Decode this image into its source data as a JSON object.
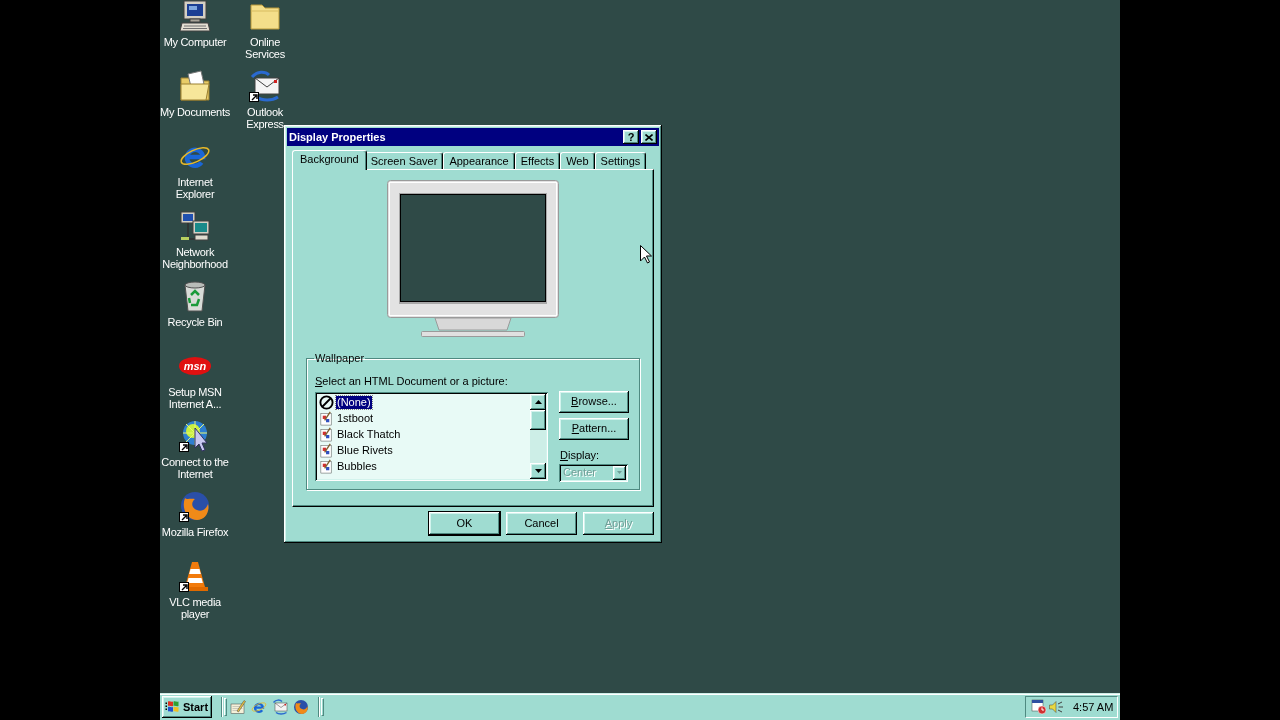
{
  "desktop": {
    "icons": [
      {
        "label": "My Computer",
        "kind": "computer",
        "shortcut": false
      },
      {
        "label": "My Documents",
        "kind": "documents",
        "shortcut": false
      },
      {
        "label": "Internet Explorer",
        "kind": "browser-e",
        "shortcut": false
      },
      {
        "label": "Network Neighborhood",
        "kind": "network",
        "shortcut": false
      },
      {
        "label": "Recycle Bin",
        "kind": "recycle",
        "shortcut": false
      },
      {
        "label": "Setup MSN Internet A...",
        "kind": "msn",
        "logo_text": "msn",
        "shortcut": false
      },
      {
        "label": "Connect to the Internet",
        "kind": "connect",
        "shortcut": true
      },
      {
        "label": "Mozilla Firefox",
        "kind": "firefox",
        "shortcut": true
      },
      {
        "label": "VLC media player",
        "kind": "cone",
        "shortcut": true
      },
      {
        "label": "Online Services",
        "kind": "folder",
        "shortcut": false
      },
      {
        "label": "Outlook Express",
        "kind": "mail",
        "shortcut": true
      }
    ]
  },
  "dialog": {
    "title": "Display Properties",
    "help_button": "?",
    "tabs": [
      {
        "label": "Background",
        "selected": true
      },
      {
        "label": "Screen Saver",
        "selected": false
      },
      {
        "label": "Appearance",
        "selected": false
      },
      {
        "label": "Effects",
        "selected": false
      },
      {
        "label": "Web",
        "selected": false
      },
      {
        "label": "Settings",
        "selected": false
      }
    ],
    "wallpaper": {
      "group_label": "Wallpaper",
      "list_label": {
        "text": "Select an HTML Document or a picture:",
        "mnemonic": true
      },
      "items": [
        {
          "label": "(None)",
          "kind": "none",
          "selected": true
        },
        {
          "label": "1stboot",
          "kind": "image",
          "selected": false
        },
        {
          "label": "Black Thatch",
          "kind": "image",
          "selected": false
        },
        {
          "label": "Blue Rivets",
          "kind": "image",
          "selected": false
        },
        {
          "label": "Bubbles",
          "kind": "image",
          "selected": false
        }
      ],
      "browse_button": {
        "label": "Browse...",
        "mnemonic": true
      },
      "pattern_button": {
        "label": "Pattern...",
        "mnemonic": true
      },
      "display_label": {
        "text": "Display:",
        "mnemonic": true
      },
      "display_select": {
        "value": "Center",
        "disabled": true
      }
    },
    "buttons": [
      {
        "label": "OK",
        "default": true,
        "disabled": false,
        "mnemonic": false
      },
      {
        "label": "Cancel",
        "default": false,
        "disabled": false,
        "mnemonic": false
      },
      {
        "label": "Apply",
        "default": false,
        "disabled": true,
        "mnemonic": true
      }
    ]
  },
  "taskbar": {
    "start_button": "Start",
    "quick_launch": [
      {
        "kind": "desktop"
      },
      {
        "kind": "browser-e"
      },
      {
        "kind": "mail"
      },
      {
        "kind": "firefox"
      }
    ],
    "tray_icons": [
      {
        "kind": "scheduler"
      },
      {
        "kind": "speaker"
      }
    ],
    "clock": "4:57 AM"
  }
}
